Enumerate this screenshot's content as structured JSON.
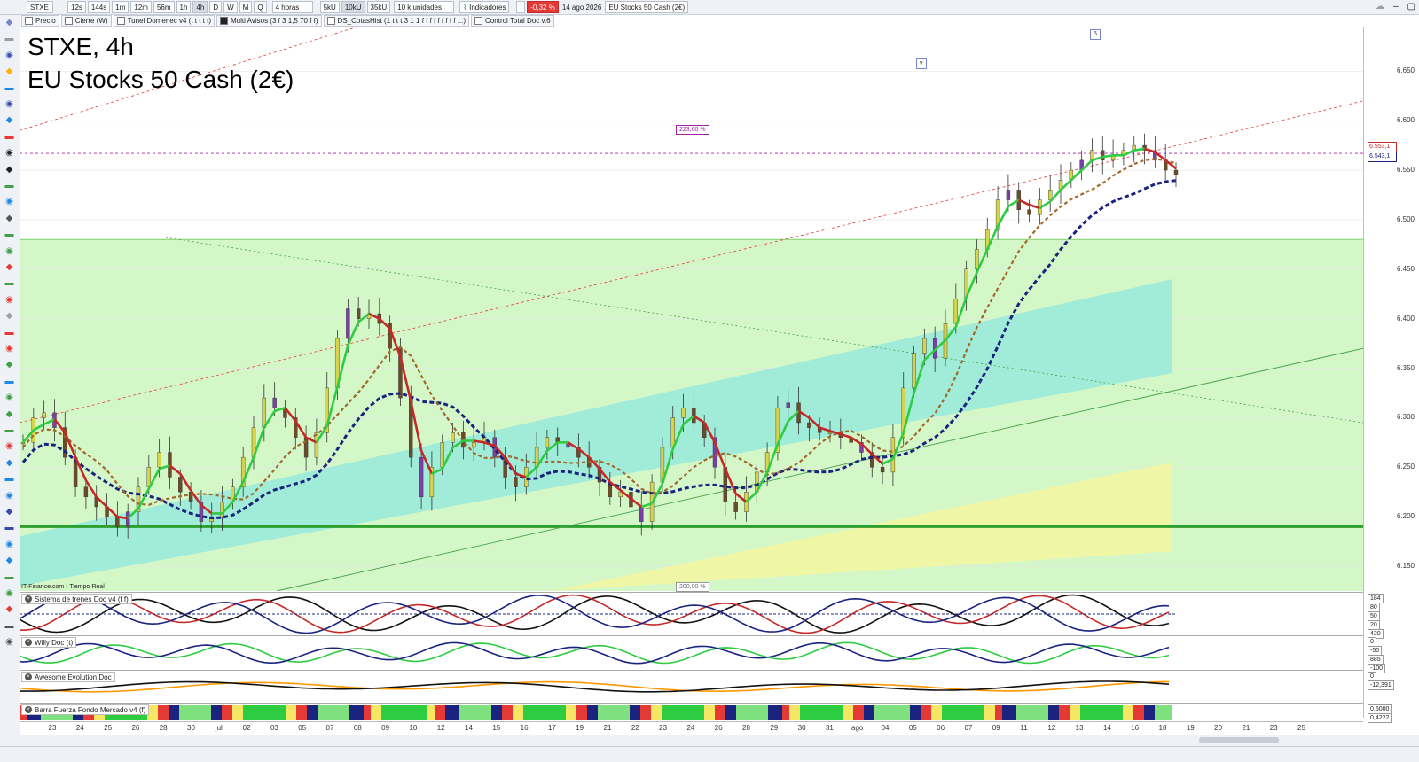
{
  "toolbar": {
    "symbol": "STXE",
    "timeframes": [
      "12s",
      "144s",
      "1m",
      "12m",
      "56m",
      "1h",
      "4h",
      "D",
      "W",
      "M",
      "Q"
    ],
    "active_timeframe": "4h",
    "period_select": "4 horas",
    "volumes": [
      "5kU",
      "10kU",
      "35kU"
    ],
    "active_volume": "10kU",
    "units_select": "10 k unidades",
    "indicators_label": "Indicadores",
    "change_pct": "-0,32 %",
    "date": "14 ago 2026",
    "instrument": "EU Stocks 50 Cash (2€)"
  },
  "indicators": [
    {
      "label": "Precio",
      "checked": false
    },
    {
      "label": "Cierre (W)",
      "checked": false
    },
    {
      "label": "Tunel Domenec v4 (t t t t t)",
      "checked": false
    },
    {
      "label": "Multi Avisos (3 f 3 1,5 70 f f)",
      "checked": true
    },
    {
      "label": "DS_CotasHist (1 t t t 3 1 1 f f f f f f f f f ...)",
      "checked": false
    },
    {
      "label": "Control Total Doc v.6",
      "checked": false
    }
  ],
  "chart": {
    "title_line1": "STXE, 4h",
    "title_line2": "EU Stocks 50 Cash (2€)",
    "source": "IT-Finance.com - Tiempo Real",
    "fib_upper": "223,60 %",
    "fib_lower": "200,00 %",
    "wave_marker_5": "5",
    "wave_marker_v": "v",
    "price_labels": [
      "6.650",
      "6.600",
      "6.550",
      "6.500",
      "6.450",
      "6.400",
      "6.350",
      "6.300",
      "6.250",
      "6.200",
      "6.150"
    ],
    "price_box_1": "6.553,1",
    "price_box_2": "6.543,1"
  },
  "subpanels": [
    {
      "title": "Sistema de trenes Doc v4 (f f)",
      "labels": [
        "184",
        "80",
        "50",
        "20",
        "420"
      ]
    },
    {
      "title": "Willy Doc (t)",
      "labels": [
        "0",
        "-50",
        "885",
        "-100"
      ]
    },
    {
      "title": "Awesome Evolution Doc",
      "labels": [
        "0",
        "-12,391"
      ]
    },
    {
      "title": "Barra Fuerza Fondo Mercado v4 (f)",
      "labels": [
        "0,5000",
        "0,4222"
      ]
    }
  ],
  "xaxis": [
    "23",
    "24",
    "25",
    "26",
    "28",
    "30",
    "jul",
    "02",
    "03",
    "05",
    "07",
    "08",
    "09",
    "10",
    "12",
    "14",
    "15",
    "16",
    "17",
    "19",
    "21",
    "22",
    "23",
    "24",
    "26",
    "28",
    "29",
    "30",
    "31",
    "ago",
    "04",
    "05",
    "06",
    "07",
    "09",
    "11",
    "12",
    "13",
    "14",
    "16",
    "18",
    "19",
    "20",
    "21",
    "23",
    "25"
  ],
  "chart_data": {
    "type": "candlestick",
    "title": "STXE, 4h",
    "ylim": [
      6125,
      6695
    ],
    "closes": [
      6275,
      6300,
      6305,
      6290,
      6260,
      6230,
      6220,
      6210,
      6200,
      6190,
      6205,
      6230,
      6250,
      6265,
      6240,
      6225,
      6215,
      6195,
      6200,
      6215,
      6230,
      6260,
      6290,
      6320,
      6310,
      6300,
      6280,
      6260,
      6285,
      6330,
      6380,
      6410,
      6400,
      6405,
      6395,
      6370,
      6320,
      6260,
      6220,
      6250,
      6275,
      6285,
      6270,
      6275,
      6280,
      6260,
      6240,
      6230,
      6250,
      6270,
      6280,
      6275,
      6270,
      6260,
      6250,
      6235,
      6220,
      6225,
      6210,
      6195,
      6235,
      6270,
      6300,
      6310,
      6295,
      6280,
      6250,
      6215,
      6205,
      6225,
      6245,
      6265,
      6310,
      6315,
      6295,
      6290,
      6285,
      6285,
      6280,
      6275,
      6265,
      6250,
      6245,
      6280,
      6330,
      6365,
      6380,
      6360,
      6395,
      6420,
      6450,
      6470,
      6490,
      6520,
      6530,
      6510,
      6505,
      6520,
      6530,
      6540,
      6550,
      6560,
      6570,
      6560,
      6565,
      6570,
      6575,
      6570,
      6560,
      6550,
      6545
    ]
  }
}
